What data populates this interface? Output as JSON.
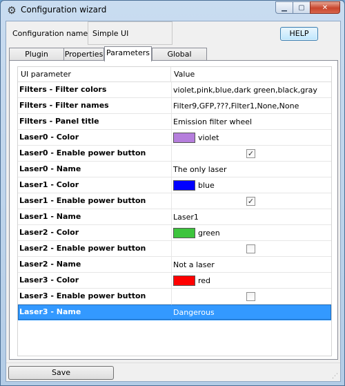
{
  "window": {
    "title": "Configuration wizard",
    "icon": "gear-icon",
    "controls": {
      "minimize": "minimize-icon",
      "maximize": "maximize-icon",
      "close": "close-icon"
    }
  },
  "header": {
    "config_name_label": "Configuration name:",
    "config_name_value": "Simple UI",
    "help_label": "HELP"
  },
  "tabs": [
    {
      "label": "Plugin Settings",
      "active": false
    },
    {
      "label": "Properties",
      "active": false
    },
    {
      "label": "Parameters",
      "active": true
    },
    {
      "label": "Global Settings",
      "active": false
    }
  ],
  "table": {
    "columns": [
      "UI parameter",
      "Value"
    ],
    "rows": [
      {
        "parameter": "Filters - Filter colors",
        "kind": "text",
        "value": "violet,pink,blue,dark green,black,gray"
      },
      {
        "parameter": "Filters - Filter names",
        "kind": "text",
        "value": "Filter9,GFP,???,Filter1,None,None"
      },
      {
        "parameter": "Filters - Panel title",
        "kind": "text",
        "value": "Emission filter wheel"
      },
      {
        "parameter": "Laser0 - Color",
        "kind": "color",
        "value": "violet",
        "swatch": "#b57edc"
      },
      {
        "parameter": "Laser0 - Enable power button",
        "kind": "checkbox",
        "checked": true
      },
      {
        "parameter": "Laser0 - Name",
        "kind": "text",
        "value": "The only laser"
      },
      {
        "parameter": "Laser1 - Color",
        "kind": "color",
        "value": "blue",
        "swatch": "#0000ff"
      },
      {
        "parameter": "Laser1 - Enable power button",
        "kind": "checkbox",
        "checked": true
      },
      {
        "parameter": "Laser1 - Name",
        "kind": "text",
        "value": "Laser1"
      },
      {
        "parameter": "Laser2 - Color",
        "kind": "color",
        "value": "green",
        "swatch": "#3cc43c"
      },
      {
        "parameter": "Laser2 - Enable power button",
        "kind": "checkbox",
        "checked": false
      },
      {
        "parameter": "Laser2 - Name",
        "kind": "text",
        "value": "Not a laser"
      },
      {
        "parameter": "Laser3 - Color",
        "kind": "color",
        "value": "red",
        "swatch": "#ff0000"
      },
      {
        "parameter": "Laser3 - Enable power button",
        "kind": "checkbox",
        "checked": false
      },
      {
        "parameter": "Laser3 - Name",
        "kind": "text",
        "value": "Dangerous",
        "selected": true
      }
    ]
  },
  "footer": {
    "save_label": "Save"
  },
  "colors": {
    "selection": "#3399ff",
    "help_button_border": "#3c7fb1",
    "close_button": "#c8452c"
  }
}
